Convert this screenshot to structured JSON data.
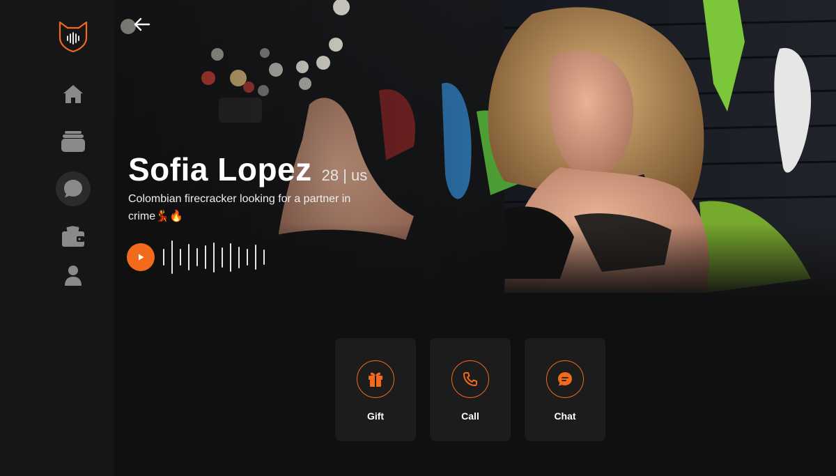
{
  "profile": {
    "name": "Sofia Lopez",
    "age_location": "28 | us",
    "tagline": "Colombian firecracker looking for a partner in crime💃🔥"
  },
  "sidebar": {
    "items": [
      {
        "id": "home",
        "icon": "home-icon"
      },
      {
        "id": "cards",
        "icon": "cards-stack-icon"
      },
      {
        "id": "chats",
        "icon": "chat-bubble-icon",
        "active": true
      },
      {
        "id": "wallet",
        "icon": "wallet-icon"
      },
      {
        "id": "profile",
        "icon": "user-icon"
      }
    ]
  },
  "voice_note": {
    "waveform": [
      0.5,
      1.0,
      0.5,
      0.8,
      0.55,
      0.7,
      0.9,
      0.6,
      0.85,
      0.65,
      0.5,
      0.75,
      0.45
    ]
  },
  "actions": [
    {
      "label": "Gift",
      "icon": "gift-icon"
    },
    {
      "label": "Call",
      "icon": "phone-icon"
    },
    {
      "label": "Chat",
      "icon": "chat-message-icon"
    }
  ],
  "colors": {
    "accent": "#f26a1b",
    "background": "#101010",
    "sidebar": "#161616",
    "card": "#1c1c1c"
  }
}
